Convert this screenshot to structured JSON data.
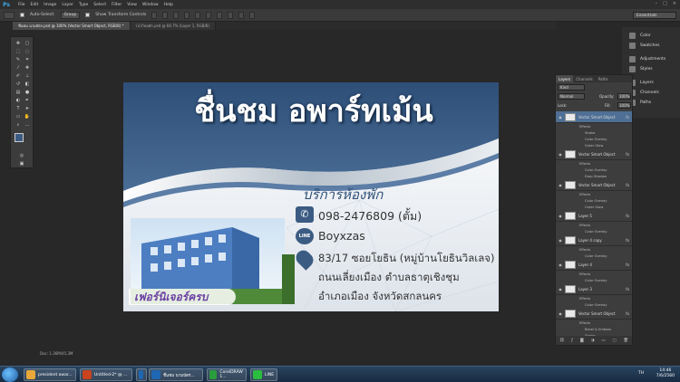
{
  "app": {
    "logo": "Ps"
  },
  "menu": [
    "File",
    "Edit",
    "Image",
    "Layer",
    "Type",
    "Select",
    "Filter",
    "View",
    "Window",
    "Help"
  ],
  "window_buttons": [
    "–",
    "□",
    "×"
  ],
  "options": {
    "auto_select_label": "Auto-Select:",
    "auto_select_value": "Group",
    "show_transform_label": "Show Transform Controls",
    "workspace": "Essentials"
  },
  "doc_tabs": [
    {
      "label": "ชื่นชม นามบัตร.psd @ 100% (Vector Smart Object, RGB/8) *",
      "active": true
    },
    {
      "label": "โลโก้หอพัก.psd @ 66.7% (Layer 1, RGB/8)",
      "active": false
    }
  ],
  "card": {
    "title": "ชื่นชม อพาร์ทเม้น",
    "subtitle": "บริการห้องพัก",
    "phone": "098-2476809 (ตั้ม)",
    "line_id": "Boyxzas",
    "line_badge": "LINE",
    "address1": "83/17 ซอยโยธิน (หมู่บ้านโยธินวิลเลจ)",
    "address2": "ถนนเลี่ยงเมือง ตำบลธาตุเชิงชุม",
    "address3": "อำเภอเมือง จังหวัดสกลนคร",
    "ribbon": "เฟอร์นิเจอร์ครบ"
  },
  "panel_strip": [
    {
      "label": "Color"
    },
    {
      "label": "Swatches"
    },
    {
      "label": "Adjustments"
    },
    {
      "label": "Styles"
    },
    {
      "label": "Layers"
    },
    {
      "label": "Channels"
    },
    {
      "label": "Paths"
    }
  ],
  "layers_panel": {
    "tabs": [
      "Layers",
      "Channels",
      "Paths"
    ],
    "kind": "Kind",
    "blend": "Normal",
    "opacity_label": "Opacity:",
    "opacity": "100%",
    "lock_label": "Lock:",
    "fill_label": "Fill:",
    "fill": "100%",
    "rows": [
      {
        "type": "layer",
        "name": "Vector Smart Object",
        "fx": "fx",
        "selected": true
      },
      {
        "type": "effect",
        "name": "Effects"
      },
      {
        "type": "effect",
        "name": "Stroke"
      },
      {
        "type": "effect",
        "name": "Color Overlay"
      },
      {
        "type": "effect",
        "name": "Outer Glow"
      },
      {
        "type": "layer",
        "name": "Vector Smart Object",
        "fx": "fx"
      },
      {
        "type": "effect",
        "name": "Effects"
      },
      {
        "type": "effect",
        "name": "Color Overlay"
      },
      {
        "type": "effect",
        "name": "Drop Shadow"
      },
      {
        "type": "layer",
        "name": "Vector Smart Object",
        "fx": "fx"
      },
      {
        "type": "effect",
        "name": "Effects"
      },
      {
        "type": "effect",
        "name": "Color Overlay"
      },
      {
        "type": "effect",
        "name": "Outer Glow"
      },
      {
        "type": "layer",
        "name": "Layer 5",
        "fx": "fx"
      },
      {
        "type": "effect",
        "name": "Effects"
      },
      {
        "type": "effect",
        "name": "Color Overlay"
      },
      {
        "type": "layer",
        "name": "Layer 4 copy",
        "fx": "fx"
      },
      {
        "type": "effect",
        "name": "Effects"
      },
      {
        "type": "effect",
        "name": "Color Overlay"
      },
      {
        "type": "layer",
        "name": "Layer 4",
        "fx": "fx"
      },
      {
        "type": "effect",
        "name": "Effects"
      },
      {
        "type": "effect",
        "name": "Color Overlay"
      },
      {
        "type": "layer",
        "name": "Layer 3",
        "fx": "fx"
      },
      {
        "type": "effect",
        "name": "Effects"
      },
      {
        "type": "effect",
        "name": "Color Overlay"
      },
      {
        "type": "layer",
        "name": "Vector Smart Object",
        "fx": "fx"
      },
      {
        "type": "effect",
        "name": "Effects"
      },
      {
        "type": "effect",
        "name": "Bevel & Emboss"
      },
      {
        "type": "effect",
        "name": "Stroke"
      }
    ]
  },
  "status": {
    "doc": "Doc: 1.36M/45.3M"
  },
  "taskbar": {
    "items": [
      {
        "label": "president awar...",
        "color": "#e8a83a"
      },
      {
        "label": "Untitled-2* @ ...",
        "color": "#c8431e"
      },
      {
        "label": "",
        "color": "#1e67b3"
      },
      {
        "label": "ชื่นชม นามบัตร...",
        "color": "#1e67b3"
      },
      {
        "label": "CorelDRAW 1...",
        "color": "#2a9d3c"
      },
      {
        "label": "LINE",
        "color": "#2bbd3f"
      }
    ],
    "lang": "TH",
    "time": "14:46",
    "date": "7/6/2560"
  },
  "colors": {
    "brand_blue": "#3b5b82",
    "line_green": "#2bbd3f",
    "ps_blue": "#39a9e6"
  }
}
